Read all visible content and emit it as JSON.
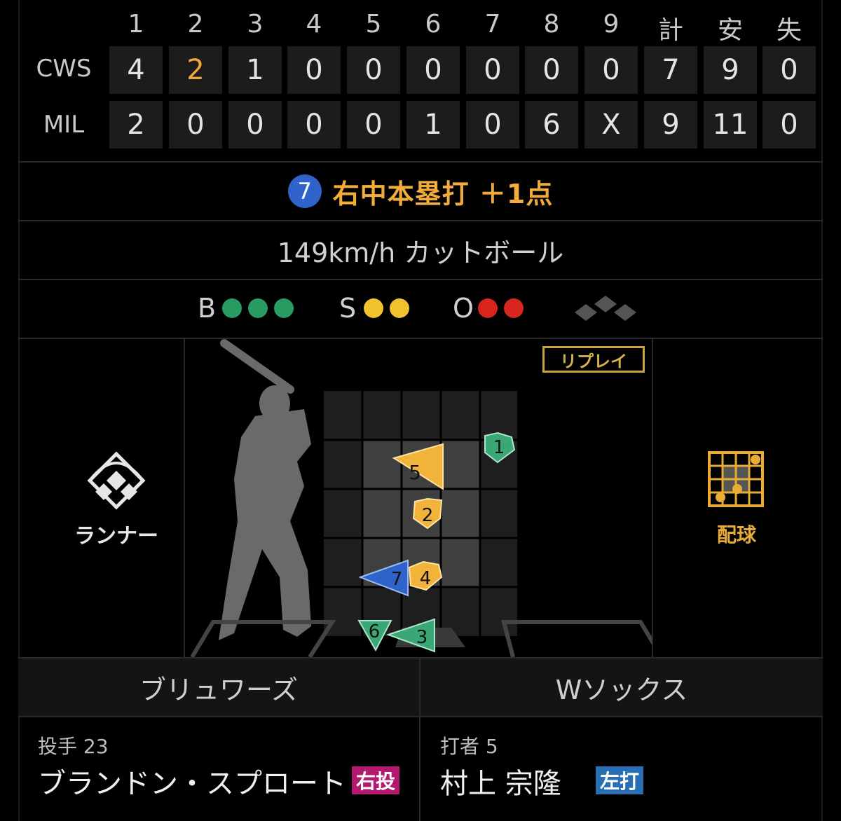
{
  "scoreboard": {
    "headers": [
      "1",
      "2",
      "3",
      "4",
      "5",
      "6",
      "7",
      "8",
      "9",
      "計",
      "安",
      "失"
    ],
    "rows": [
      {
        "team": "CWS",
        "cells": [
          "4",
          "2",
          "1",
          "0",
          "0",
          "0",
          "0",
          "0",
          "0",
          "7",
          "9",
          "0"
        ]
      },
      {
        "team": "MIL",
        "cells": [
          "2",
          "0",
          "0",
          "0",
          "0",
          "1",
          "0",
          "6",
          "X",
          "9",
          "11",
          "0"
        ]
      }
    ],
    "highlight_color": "#f0a83a"
  },
  "event": {
    "pitch_number": "7",
    "text": "右中本塁打 ＋1点"
  },
  "pitch": {
    "text": "149km/h カットボール"
  },
  "count": {
    "ball_label": "B",
    "strike_label": "S",
    "out_label": "O",
    "balls": 3,
    "strikes": 2,
    "outs": 2,
    "ball_color": "#2a9a63",
    "strike_color": "#f1c22e",
    "out_color": "#d8261e"
  },
  "replay_label": "リプレイ",
  "runner_label": "ランナー",
  "sequence_label": "配球",
  "pitches": [
    {
      "num": "1",
      "color": "#3aa777",
      "shape": "pentagon"
    },
    {
      "num": "2",
      "color": "#f1b33a",
      "shape": "pentagon"
    },
    {
      "num": "3",
      "color": "#3aa777",
      "shape": "triangle-left"
    },
    {
      "num": "4",
      "color": "#f1b33a",
      "shape": "pentagon"
    },
    {
      "num": "5",
      "color": "#f1b33a",
      "shape": "triangle-left"
    },
    {
      "num": "6",
      "color": "#3aa777",
      "shape": "triangle-down"
    },
    {
      "num": "7",
      "color": "#2f63c9",
      "shape": "triangle-left"
    }
  ],
  "teams": {
    "home": "ブリュワーズ",
    "away": "Wソックス"
  },
  "pitcher": {
    "role": "投手 23",
    "name": "ブランドン・スプロート",
    "tag": "右投",
    "tag_color": "#b2196f"
  },
  "batter": {
    "role": "打者 5",
    "name": "村上 宗隆",
    "tag": "左打",
    "tag_color": "#2a6fb3"
  }
}
